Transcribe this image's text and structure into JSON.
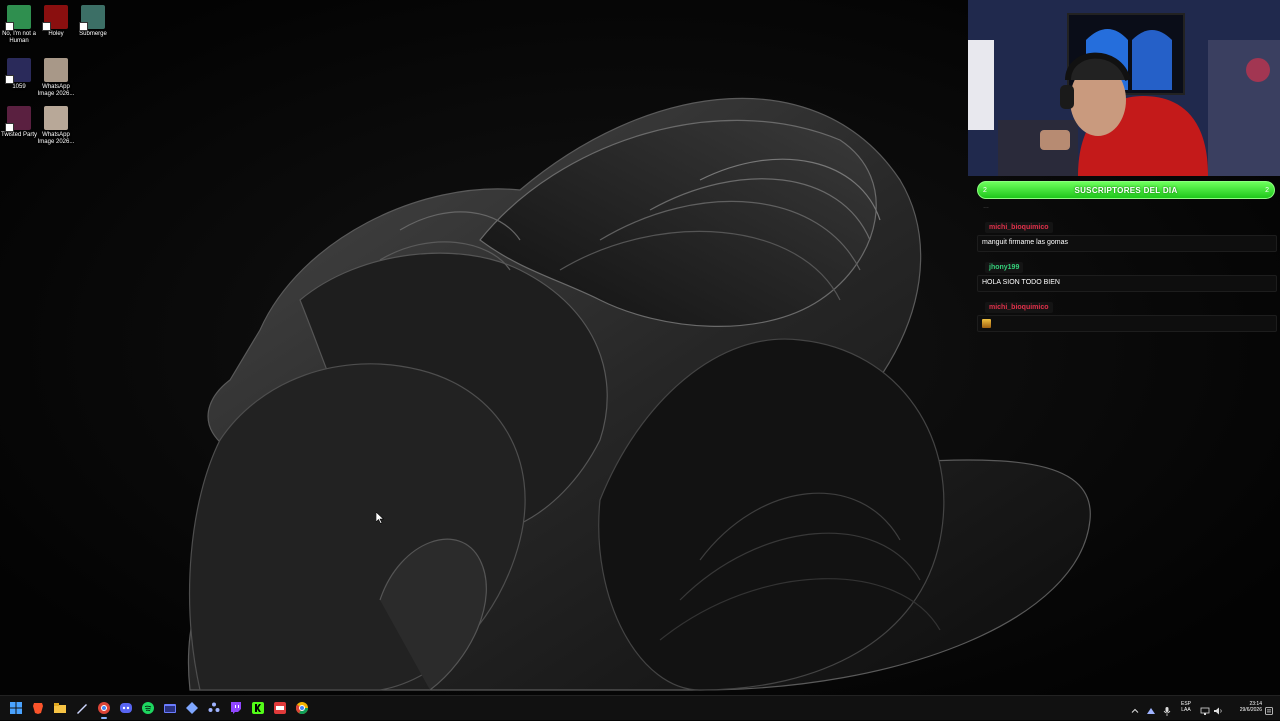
{
  "desktop": {
    "icons": [
      {
        "label": "No, I'm not a Human",
        "color": "#2f8f4f"
      },
      {
        "label": "Holey",
        "color": "#8a0f0f"
      },
      {
        "label": "Submerge",
        "color": "#3c6f66"
      },
      {
        "label": "1059",
        "color": "#2a2a5a"
      },
      {
        "label": "WhatsApp Image 2026...",
        "color": "#a89888"
      },
      {
        "label": "Twisted Party",
        "color": "#5a2040"
      },
      {
        "label": "WhatsApp Image 2026...",
        "color": "#b8a898"
      }
    ]
  },
  "stream_overlay": {
    "subs_bar": {
      "title": "SUSCRIPTORES DEL DIA",
      "count_left": "2",
      "count_right": "2",
      "color": "#2ee02a"
    },
    "chat": {
      "faded_line": "…",
      "messages": [
        {
          "user": "michi_bioquimico",
          "text": "manguit firmame las gomas",
          "user_color": "#e0304a"
        },
        {
          "user": "jhony199",
          "text": "HOLA SION TODO BIEN",
          "user_color": "#34d17a"
        },
        {
          "user": "michi_bioquimico",
          "text": "",
          "user_color": "#e0304a",
          "emote": "gold-emote"
        }
      ]
    }
  },
  "taskbar": {
    "apps": [
      "windows-start-icon",
      "brave-browser-icon",
      "file-explorer-icon",
      "stylus-icon",
      "chrome-active-icon",
      "discord-icon",
      "spotify-icon",
      "window-app-icon",
      "network-app-icon",
      "puzzle-app-icon",
      "twitch-icon",
      "kick-icon",
      "game-launcher-icon",
      "chrome-icon"
    ],
    "tray": {
      "language_top": "ESP",
      "language_bottom": "LAA",
      "time": "23:14",
      "date": "29/6/2026"
    }
  }
}
